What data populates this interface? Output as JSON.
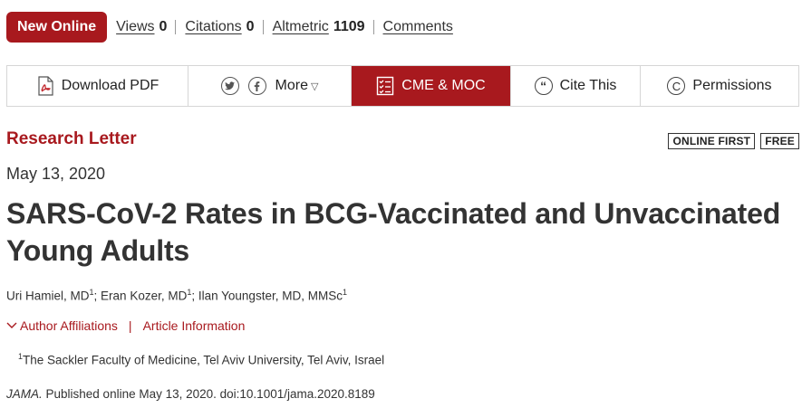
{
  "metrics": {
    "new_label": "New Online",
    "views_label": "Views",
    "views_value": "0",
    "citations_label": "Citations",
    "citations_value": "0",
    "altmetric_label": "Altmetric",
    "altmetric_value": "1109",
    "comments_label": "Comments"
  },
  "toolbar": {
    "download_pdf": "Download PDF",
    "more": "More",
    "cme": "CME & MOC",
    "cite": "Cite This",
    "permissions": "Permissions",
    "icons": [
      "pdf-icon",
      "twitter-icon",
      "facebook-icon",
      "checklist-icon",
      "quote-icon",
      "copyright-icon"
    ],
    "accent_color": "#a8191e"
  },
  "article": {
    "type": "Research Letter",
    "tag_online_first": "ONLINE FIRST",
    "tag_free": "FREE",
    "date": "May 13, 2020",
    "title": "SARS-CoV-2 Rates in BCG-Vaccinated and Unvaccinated Young Adults",
    "authors": [
      {
        "name": "Uri Hamiel, MD",
        "sup": "1",
        "sep": "; "
      },
      {
        "name": "Eran Kozer, MD",
        "sup": "1",
        "sep": "; "
      },
      {
        "name": "Ilan Youngster, MD, MMSc",
        "sup": "1",
        "sep": ""
      }
    ],
    "author_affiliations_link": "Author Affiliations",
    "article_information_link": "Article Information",
    "affiliation_sup": "1",
    "affiliation_text": "The Sackler Faculty of Medicine, Tel Aviv University, Tel Aviv, Israel",
    "journal": "JAMA.",
    "citation_text": " Published online May 13, 2020. doi:10.1001/jama.2020.8189"
  }
}
